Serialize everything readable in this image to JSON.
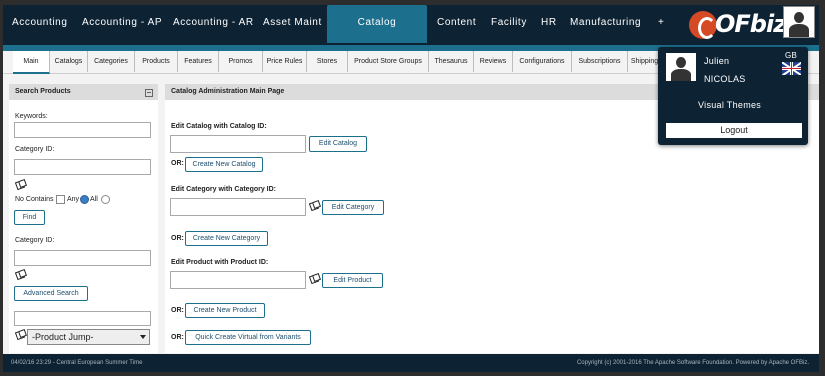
{
  "nav": {
    "items": [
      "Accounting",
      "Accounting - AP",
      "Accounting - AR",
      "Asset Maint",
      "Catalog",
      "Content",
      "Facility",
      "HR",
      "Manufacturing",
      "+"
    ],
    "active": "Catalog",
    "logo": "OFbiz"
  },
  "tabs": [
    "Main",
    "Catalogs",
    "Categories",
    "Products",
    "Features",
    "Promos",
    "Price Rules",
    "Stores",
    "Product Store Groups",
    "Thesaurus",
    "Reviews",
    "Configurations",
    "Subscriptions",
    "Shipping"
  ],
  "search": {
    "title": "Search Products",
    "keywords_label": "Keywords:",
    "category_label": "Category ID:",
    "no_contains": "No Contains",
    "any": "Any",
    "all": "All",
    "find": "Find",
    "category2_label": "Category ID:",
    "advanced": "Advanced Search",
    "product_jump": "-Product Jump-"
  },
  "main": {
    "title": "Catalog Administration Main Page",
    "edit_catalog_label": "Edit Catalog with Catalog ID:",
    "edit_catalog_btn": "Edit Catalog",
    "or": "OR:",
    "create_catalog": "Create New Catalog",
    "edit_category_label": "Edit Category with Category ID:",
    "edit_category_btn": "Edit Category",
    "create_category": "Create New Category",
    "edit_product_label": "Edit Product with Product ID:",
    "edit_product_btn": "Edit Product",
    "create_product": "Create New Product",
    "quick_virtual": "Quick Create Virtual from Variants"
  },
  "user": {
    "first": "Julien",
    "last": "NICOLAS",
    "lang": "GB",
    "visual_themes": "Visual Themes",
    "logout": "Logout"
  },
  "footer": {
    "left": "04/02/16 23:29 - Central European Summer Time",
    "right": "Copyright (c) 2001-2016 The Apache Software Foundation. Powered by Apache OFBiz."
  }
}
